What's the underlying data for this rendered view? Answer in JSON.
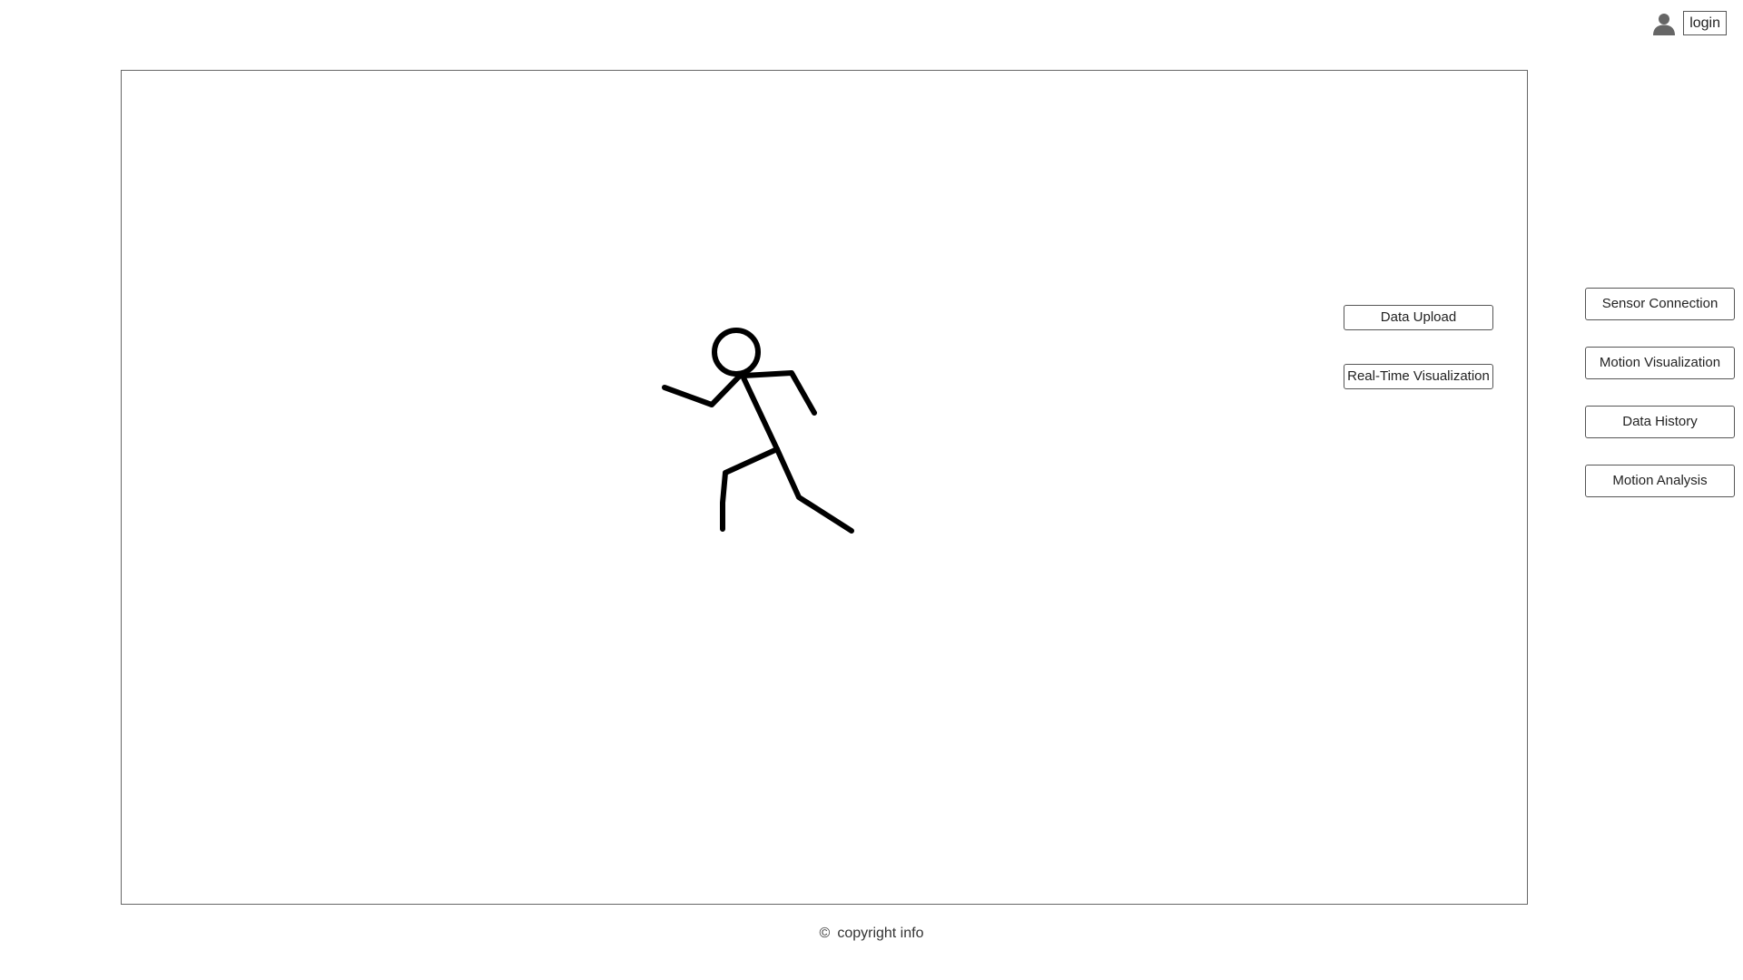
{
  "header": {
    "user_icon": "user-icon",
    "login_label": "login"
  },
  "canvas": {
    "figure_icon": "running-stick-figure",
    "buttons": {
      "data_upload": "Data Upload",
      "realtime_visualization": "Real-Time Visualization"
    }
  },
  "side_nav": {
    "items": [
      {
        "label": "Sensor Connection"
      },
      {
        "label": "Motion Visualization"
      },
      {
        "label": "Data History"
      },
      {
        "label": "Motion Analysis"
      }
    ]
  },
  "footer": {
    "copyright_symbol": "©",
    "copyright_text": "copyright info"
  }
}
